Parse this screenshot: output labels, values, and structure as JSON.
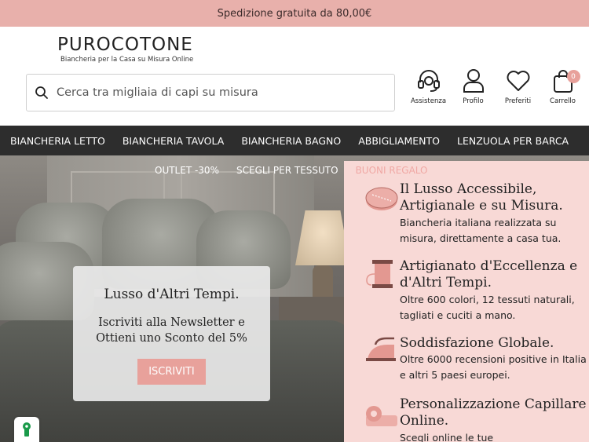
{
  "topbar": {
    "text": "Spedizione gratuita da 80,00€"
  },
  "logo": {
    "title": "PUROCOTONE",
    "subtitle": "Biancheria per la Casa su Misura Online"
  },
  "search": {
    "placeholder": "Cerca tra migliaia di capi su misura",
    "icon": "search-icon"
  },
  "actions": [
    {
      "label": "Assistenza",
      "icon": "headset-icon"
    },
    {
      "label": "Profilo",
      "icon": "user-icon"
    },
    {
      "label": "Preferiti",
      "icon": "heart-icon"
    },
    {
      "label": "Carrello",
      "icon": "cart-bag-icon",
      "count": "0"
    }
  ],
  "nav": [
    {
      "label": "BIANCHERIA LETTO"
    },
    {
      "label": "BIANCHERIA TAVOLA"
    },
    {
      "label": "BIANCHERIA BAGNO"
    },
    {
      "label": "ABBIGLIAMENTO"
    },
    {
      "label": "LENZUOLA PER BARCA"
    }
  ],
  "submenu": [
    {
      "label": "OUTLET -30%"
    },
    {
      "label": "SCEGLI PER TESSUTO"
    },
    {
      "label": "BUONI REGALO"
    }
  ],
  "newsletter": {
    "title": "Lusso d'Altri Tempi.",
    "text": "Iscriviti alla Newsletter e Ottieni uno Sconto del 5%",
    "button": "ISCRIVITI"
  },
  "benefits": [
    {
      "icon": "measuring-tape-icon",
      "title": "Il Lusso Accessibile, Artigianale e su Misura.",
      "text": "Biancheria italiana realizzata su misura, direttamente a casa tua."
    },
    {
      "icon": "thread-spool-icon",
      "title": "Artigianato d'Eccellenza e d'Altri Tempi.",
      "text": "Oltre 600 colori, 12 tessuti naturali, tagliati e cuciti a mano."
    },
    {
      "icon": "iron-icon",
      "title": "Soddisfazione Globale.",
      "text": "Oltre 6000 recensioni positive in Italia e altri 5 paesi europei."
    },
    {
      "icon": "fabric-roll-icon",
      "title": "Personalizzazione Capillare Online.",
      "text": "Scegli online le tue"
    }
  ],
  "colors": {
    "topbar": "#e8b0ab",
    "accent": "#e8a19b",
    "nav": "#2d2d2d",
    "benefits_bg": "#f8d9d6"
  }
}
